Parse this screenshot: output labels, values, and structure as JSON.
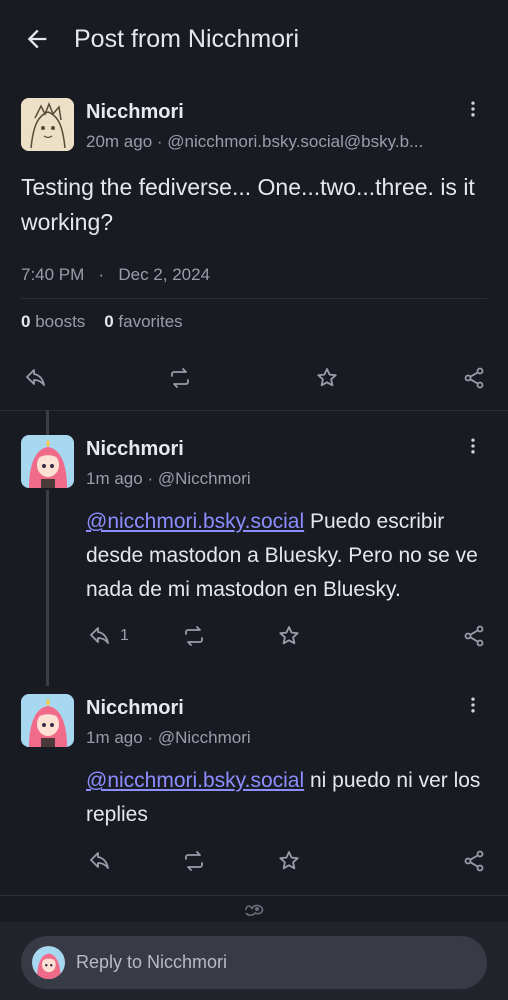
{
  "header": {
    "title": "Post from Nicchmori"
  },
  "main_post": {
    "author": "Nicchmori",
    "time_ago": "20m ago",
    "handle": "@nicchmori.bsky.social@bsky.b...",
    "content": "Testing the fediverse... One...two...three. is it working?",
    "time": "7:40 PM",
    "date": "Dec 2, 2024",
    "boosts_count": "0",
    "boosts_label": "boosts",
    "favorites_count": "0",
    "favorites_label": "favorites"
  },
  "replies": [
    {
      "author": "Nicchmori",
      "time_ago": "1m ago",
      "handle": "@Nicchmori",
      "mention": "@nicchmori.bsky.social",
      "text": " Puedo escribir desde mastodon a Bluesky. Pero no se ve nada de mi mastodon en Bluesky.",
      "reply_count": "1"
    },
    {
      "author": "Nicchmori",
      "time_ago": "1m ago",
      "handle": "@Nicchmori",
      "mention": "@nicchmori.bsky.social",
      "text": " ni puedo ni ver los replies",
      "reply_count": ""
    }
  ],
  "composer": {
    "placeholder": "Reply to Nicchmori"
  },
  "colors": {
    "background": "#191b22",
    "mention": "#8c8dff",
    "muted": "#9a9caa"
  }
}
